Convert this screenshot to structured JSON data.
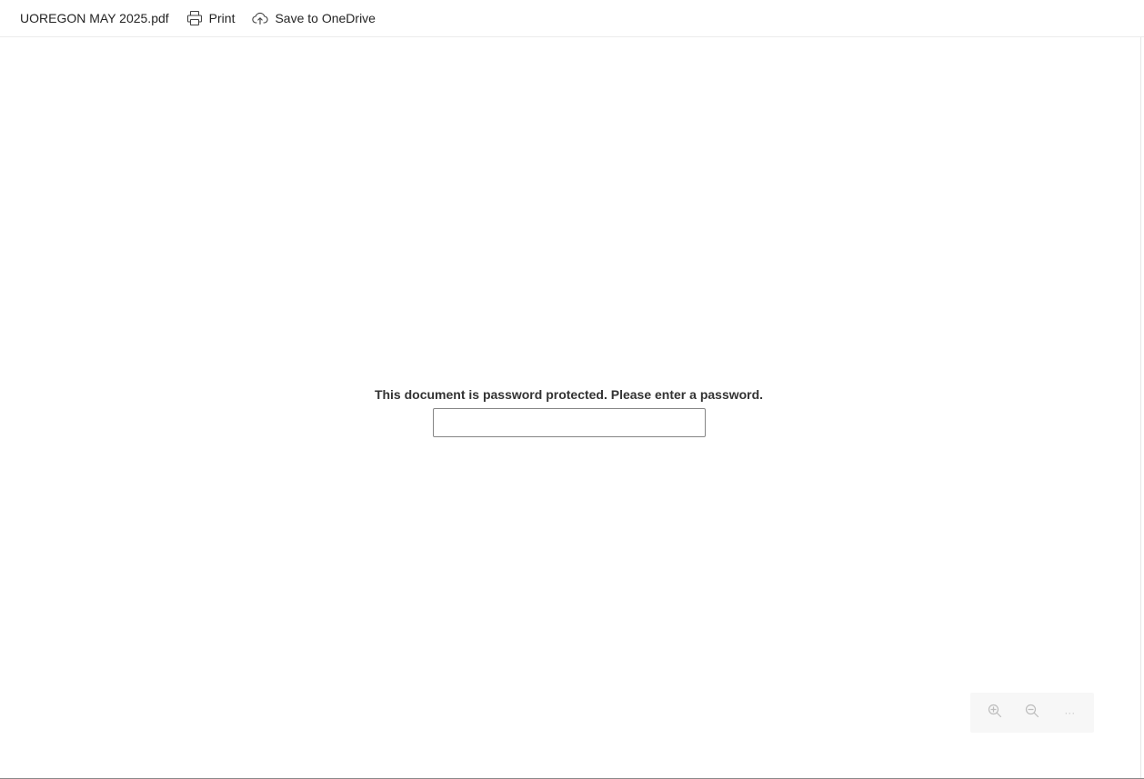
{
  "toolbar": {
    "file_name": "UOREGON MAY 2025.pdf",
    "print_label": "Print",
    "save_label": "Save to OneDrive",
    "print_icon": "printer-icon",
    "save_icon": "cloud-upload-icon"
  },
  "password": {
    "prompt": "This document is password protected. Please enter a password.",
    "value": ""
  },
  "zoom_controls": {
    "zoom_in_icon": "zoom-in-icon",
    "zoom_out_icon": "zoom-out-icon",
    "more_icon": "more-options-icon",
    "more_glyph": "···"
  },
  "colors": {
    "text": "#242424",
    "prompt_text": "#333333",
    "input_border": "#858585",
    "disabled_icon": "#c8c8c8",
    "panel_bg": "#f7f7f7"
  }
}
